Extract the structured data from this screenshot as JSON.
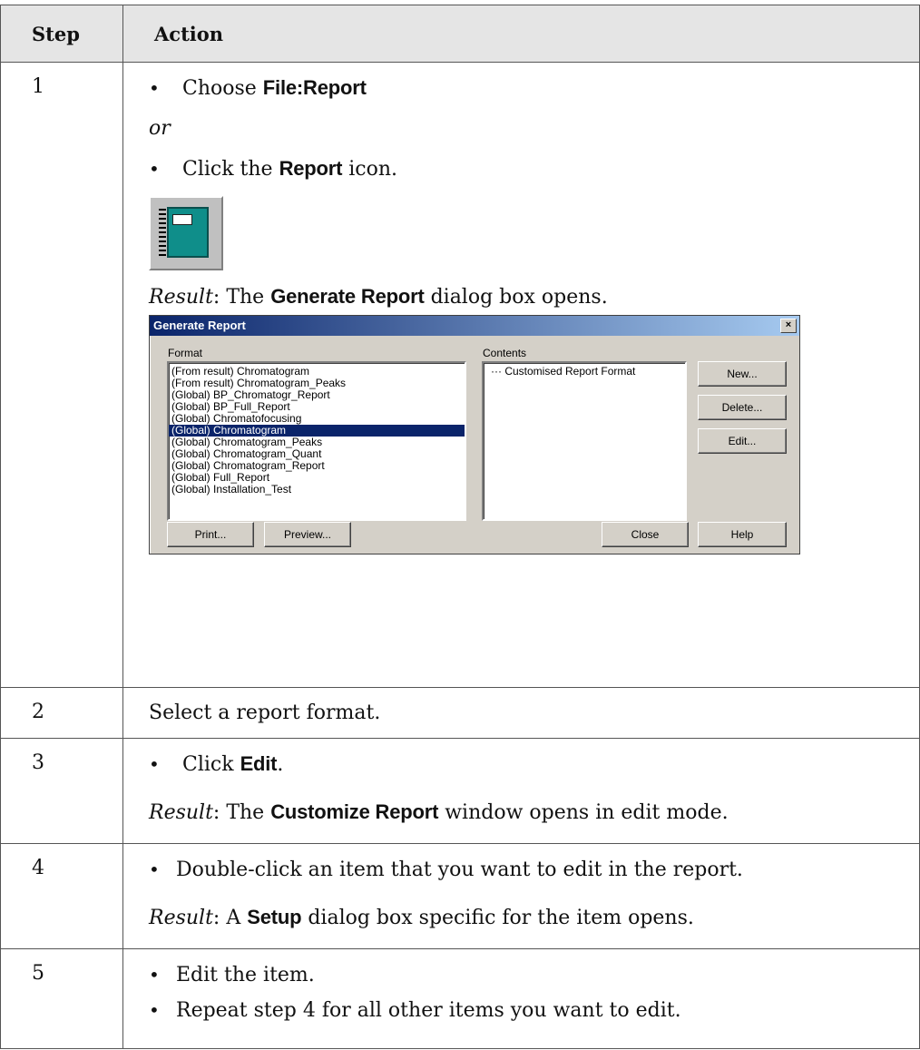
{
  "table": {
    "headers": {
      "step": "Step",
      "action": "Action"
    },
    "rows": [
      {
        "step": "1",
        "choose_pre": "Choose ",
        "choose_bold": "File:Report",
        "or": "or",
        "click_pre": "Click the ",
        "click_bold": "Report",
        "click_post": " icon.",
        "result_label": "Result",
        "result_pre": ": The ",
        "result_bold": "Generate Report",
        "result_post": " dialog box opens."
      },
      {
        "step": "2",
        "text": "Select a report format."
      },
      {
        "step": "3",
        "bullet_pre": "Click ",
        "bullet_bold": "Edit",
        "bullet_post": ".",
        "result_label": "Result",
        "result_pre": ": The ",
        "result_bold": "Customize Report",
        "result_post": " window opens in edit mode."
      },
      {
        "step": "4",
        "bullet": "Double-click an item that you want to edit in the report.",
        "result_label": "Result",
        "result_pre": ": A ",
        "result_bold": "Setup",
        "result_post": " dialog box specific for the item opens."
      },
      {
        "step": "5",
        "bullet1": "Edit the item.",
        "bullet2": "Repeat step 4 for all other items you want to edit."
      }
    ]
  },
  "dialog": {
    "title": "Generate Report",
    "close_glyph": "×",
    "format_label": "Format",
    "contents_label": "Contents",
    "format_items": [
      "(From result) Chromatogram",
      "(From result) Chromatogram_Peaks",
      "(Global) BP_Chromatogr_Report",
      "(Global) BP_Full_Report",
      "(Global) Chromatofocusing",
      "(Global) Chromatogram",
      "(Global) Chromatogram_Peaks",
      "(Global) Chromatogram_Quant",
      "(Global) Chromatogram_Report",
      "(Global) Full_Report",
      "(Global) Installation_Test"
    ],
    "selected_format": "(Global) Chromatogram",
    "contents_items": [
      "··· Customised Report Format"
    ],
    "buttons": {
      "new": "New...",
      "delete": "Delete...",
      "edit": "Edit...",
      "print": "Print...",
      "preview": "Preview...",
      "close": "Close",
      "help": "Help"
    }
  },
  "icons": {
    "report": "report-book-icon"
  },
  "colors": {
    "title_start": "#0a246a",
    "title_end": "#a6caf0",
    "selection": "#0a246a",
    "icon_book": "#0f8e8a",
    "dialog_bg": "#d4d0c8",
    "header_bg": "#e5e5e5"
  }
}
